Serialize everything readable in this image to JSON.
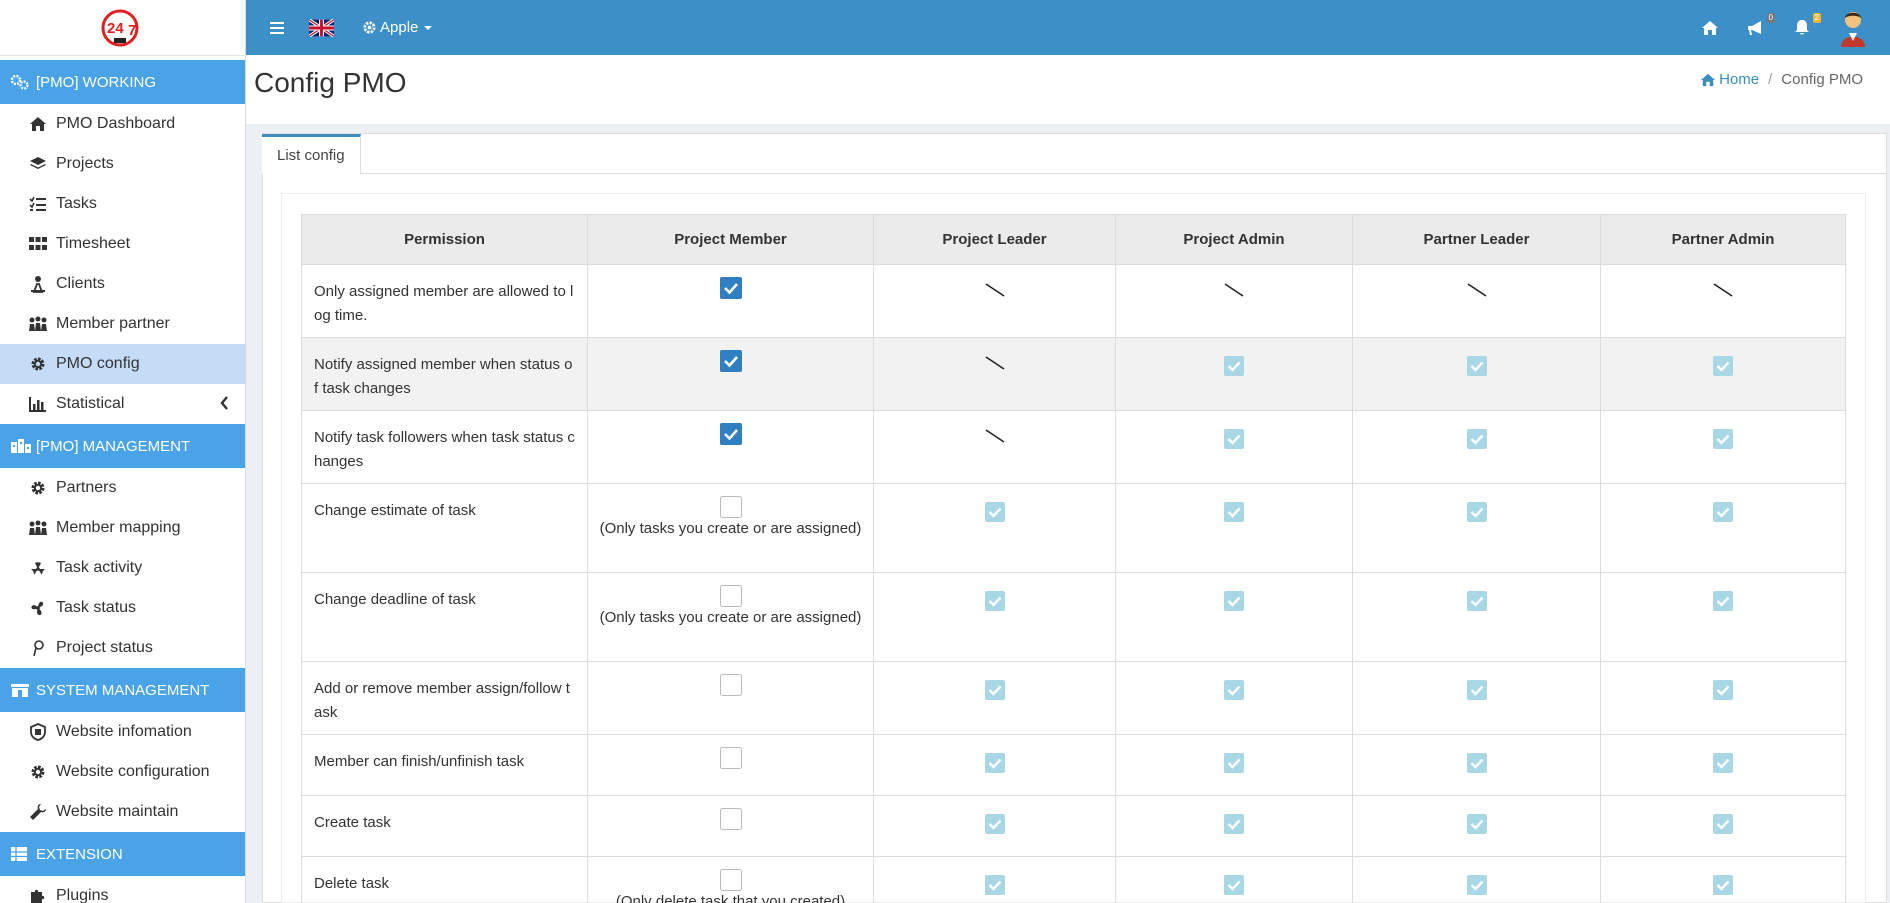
{
  "sidebar": {
    "logo_text": "24/7",
    "sections": [
      {
        "label": "[PMO] WORKING",
        "items": [
          {
            "label": "PMO Dashboard",
            "icon": "home-icon"
          },
          {
            "label": "Projects",
            "icon": "layers-icon"
          },
          {
            "label": "Tasks",
            "icon": "list-icon"
          },
          {
            "label": "Timesheet",
            "icon": "grid-icon"
          },
          {
            "label": "Clients",
            "icon": "user-icon"
          },
          {
            "label": "Member partner",
            "icon": "users-icon"
          },
          {
            "label": "PMO config",
            "icon": "gear-icon",
            "active": true
          },
          {
            "label": "Statistical",
            "icon": "bar-chart-icon"
          }
        ]
      },
      {
        "label": "[PMO] MANAGEMENT",
        "items": [
          {
            "label": "Partners",
            "icon": "gear-icon"
          },
          {
            "label": "Member mapping",
            "icon": "users-icon"
          },
          {
            "label": "Task activity",
            "icon": "radiation-icon"
          },
          {
            "label": "Task status",
            "icon": "fan-icon"
          },
          {
            "label": "Project status",
            "icon": "hashtag-icon"
          }
        ]
      },
      {
        "label": "SYSTEM MANAGEMENT",
        "items": [
          {
            "label": "Website infomation",
            "icon": "info-icon"
          },
          {
            "label": "Website configuration",
            "icon": "gear-icon"
          },
          {
            "label": "Website maintain",
            "icon": "wrench-icon"
          }
        ]
      },
      {
        "label": "EXTENSION",
        "items": [
          {
            "label": "Plugins",
            "icon": "puzzle-icon"
          }
        ]
      }
    ]
  },
  "topbar": {
    "company": "Apple",
    "notifications_count": "0",
    "alerts_count": "2"
  },
  "page": {
    "title": "Config PMO",
    "breadcrumb_home": "Home",
    "breadcrumb_current": "Config PMO",
    "tab_label": "List config"
  },
  "table": {
    "headers": [
      "Permission",
      "Project Member",
      "Project Leader",
      "Project Admin",
      "Partner Leader",
      "Partner Admin"
    ],
    "rows": [
      {
        "label": "Only assigned member are allowed to log time.",
        "member": "checked",
        "member_note": "",
        "leader": "dash",
        "admin": "dash",
        "p_leader": "dash",
        "p_admin": "dash"
      },
      {
        "label": "Notify assigned member when status of task changes",
        "member": "checked",
        "member_note": "",
        "leader": "dash",
        "admin": "disabled",
        "p_leader": "disabled",
        "p_admin": "disabled"
      },
      {
        "label": "Notify task followers when task status changes",
        "member": "checked",
        "member_note": "",
        "leader": "dash",
        "admin": "disabled",
        "p_leader": "disabled",
        "p_admin": "disabled"
      },
      {
        "label": "Change estimate of task",
        "member": "unchecked",
        "member_note": "(Only tasks you create or are assigned)",
        "leader": "disabled",
        "admin": "disabled",
        "p_leader": "disabled",
        "p_admin": "disabled"
      },
      {
        "label": "Change deadline of task",
        "member": "unchecked",
        "member_note": "(Only tasks you create or are assigned)",
        "leader": "disabled",
        "admin": "disabled",
        "p_leader": "disabled",
        "p_admin": "disabled"
      },
      {
        "label": "Add or remove member assign/follow task",
        "member": "unchecked",
        "member_note": "",
        "leader": "disabled",
        "admin": "disabled",
        "p_leader": "disabled",
        "p_admin": "disabled"
      },
      {
        "label": "Member can finish/unfinish task",
        "member": "unchecked",
        "member_note": "",
        "leader": "disabled",
        "admin": "disabled",
        "p_leader": "disabled",
        "p_admin": "disabled"
      },
      {
        "label": "Create task",
        "member": "unchecked",
        "member_note": "",
        "leader": "disabled",
        "admin": "disabled",
        "p_leader": "disabled",
        "p_admin": "disabled"
      },
      {
        "label": "Delete task",
        "member": "unchecked",
        "member_note": "(Only delete task that you created)",
        "leader": "disabled",
        "admin": "disabled",
        "p_leader": "disabled",
        "p_admin": "disabled"
      }
    ]
  },
  "colors": {
    "topbar": "#3d8fc7",
    "sidebar_section": "#4aa3e6",
    "sidebar_active": "#c5dcf7",
    "checkbox_checked": "#2f7fc1",
    "checkbox_disabled": "#a8d8e6"
  }
}
